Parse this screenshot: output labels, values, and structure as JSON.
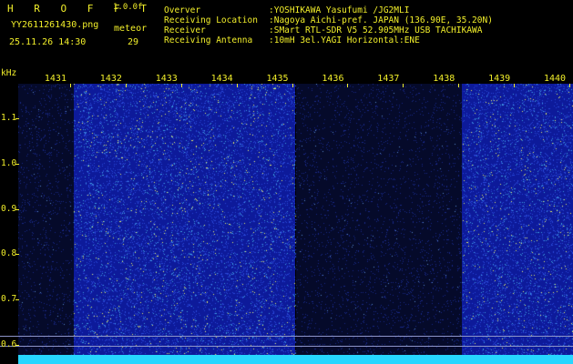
{
  "header": {
    "title_left": "H R O F F T",
    "version": "1.0.0f",
    "filename": "YY2611261430.png",
    "timestamp": "25.11.26 14:30",
    "meteor_label": "meteor",
    "meteor_count": "29"
  },
  "info": [
    {
      "label": "Overver",
      "value": ":YOSHIKAWA Yasufumi /JG2MLI"
    },
    {
      "label": "Receiving Location",
      "value": ":Nagoya Aichi-pref. JAPAN (136.90E, 35.20N)"
    },
    {
      "label": "Receiver",
      "value": ":SMart RTL-SDR V5 52.905MHz USB TACHIKAWA"
    },
    {
      "label": "Receiving Antenna",
      "value": ":10mH 3el.YAGI Horizontal:ENE"
    }
  ],
  "axis": {
    "y_unit": "kHz",
    "y_ticks": [
      "1.1",
      "1.0",
      "0.9",
      "0.8",
      "0.7",
      "0.6"
    ],
    "x_ticks": [
      "1431",
      "1432",
      "1433",
      "1434",
      "1435",
      "1436",
      "1437",
      "1438",
      "1439",
      "1440"
    ]
  },
  "colors": {
    "text": "#f2ef2a",
    "bright": "#0d1a9a",
    "dark": "#050a2a",
    "cyan": "#26d6ff"
  },
  "bands": [
    {
      "from": 0,
      "to": 1,
      "level": "dark"
    },
    {
      "from": 1,
      "to": 5,
      "level": "bright"
    },
    {
      "from": 5,
      "to": 8,
      "level": "dark"
    },
    {
      "from": 8,
      "to": 10,
      "level": "bright"
    }
  ]
}
